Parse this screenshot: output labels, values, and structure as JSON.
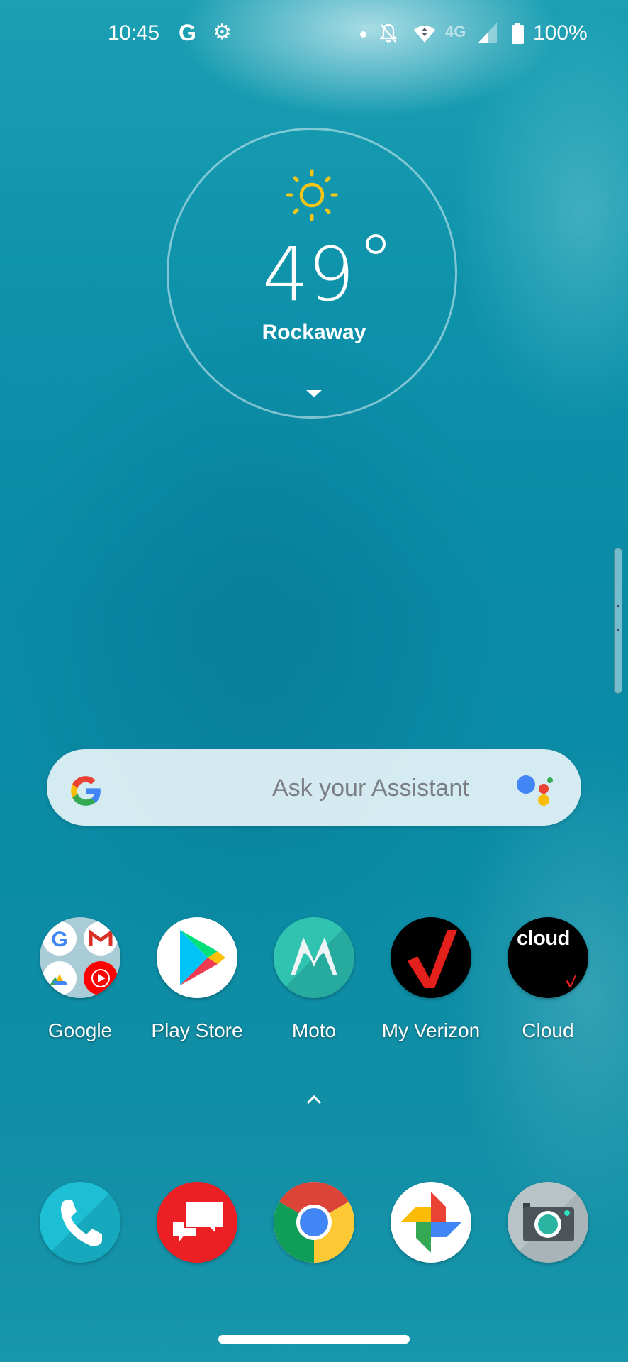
{
  "status_bar": {
    "time": "10:45",
    "google_icon_letter": "G",
    "settings_icon": "gear-icon",
    "notification_dot_icon": "dot-icon",
    "notifications_muted_icon": "bell-off-icon",
    "wifi_icon": "wifi-data-icon",
    "network_type": "4G",
    "signal_icon": "cell-signal-icon",
    "battery_icon": "battery-full-icon",
    "battery_percent": "100%"
  },
  "weather_widget": {
    "condition_icon": "sun-icon",
    "temperature": "49",
    "degree_symbol": "°",
    "location": "Rockaway",
    "expand_icon": "caret-down-icon"
  },
  "search_bar": {
    "logo_icon": "google-g-icon",
    "placeholder": "Ask your Assistant",
    "assistant_icon": "google-assistant-icon"
  },
  "apps": [
    {
      "label": "Google",
      "icon": "google-folder-icon"
    },
    {
      "label": "Play Store",
      "icon": "play-store-icon"
    },
    {
      "label": "Moto",
      "icon": "moto-icon"
    },
    {
      "label": "My Verizon",
      "icon": "verizon-check-icon"
    },
    {
      "label": "Cloud",
      "icon": "verizon-cloud-icon",
      "icon_text": "cloud"
    }
  ],
  "app_drawer_hint_icon": "caret-up-icon",
  "dock": [
    {
      "name": "Phone",
      "icon": "phone-icon"
    },
    {
      "name": "Messages",
      "icon": "messages-icon"
    },
    {
      "name": "Chrome",
      "icon": "chrome-icon"
    },
    {
      "name": "Photos",
      "icon": "photos-pinwheel-icon"
    },
    {
      "name": "Camera",
      "icon": "camera-icon"
    }
  ],
  "colors": {
    "wallpaper": "#0a8aa5",
    "sun": "#f5c518",
    "verizon_red": "#e3201b",
    "messages_red": "#ec2024",
    "moto_teal": "#2ab5a3"
  }
}
